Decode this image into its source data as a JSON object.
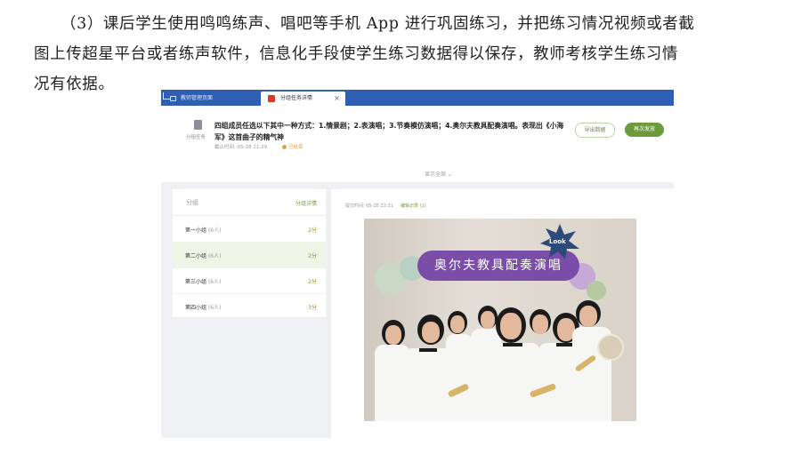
{
  "paragraph": {
    "line1": "（3）课后学生使用鸣鸣练声、唱吧等手机 App 进行巩固练习，并把练习情况视频或者截",
    "line2": "图上传超星平台或者练声软件，信息化手段使学生练习数据得以保存，教师考核学生练习情",
    "line3": "况有依据。"
  },
  "screenshot": {
    "tabs": [
      {
        "label": "教师管理页面"
      },
      {
        "label": "分组任务详情",
        "close": "×"
      }
    ],
    "task": {
      "icon_label": "分组任务",
      "title": "四组成员任选以下其中一种方式：1.情景剧；2.表演唱；3.节奏模仿演唱；4.奥尔夫教具配奏演唱。表现出《小海军》这首曲子的精气神",
      "deadline": "截止时间: 05-28 11:29",
      "status": "已结束",
      "export_button": "导出数据",
      "redo_button": "再次发放",
      "show_all": "显示全部 ⌄"
    },
    "groups": {
      "header_left": "分组",
      "header_right": "分组详情",
      "items": [
        {
          "name": "第一小组",
          "count": "(6人)",
          "score": "2分"
        },
        {
          "name": "第二小组",
          "count": "(6人)",
          "score": "2分"
        },
        {
          "name": "第三小组",
          "count": "(6人)",
          "score": "2分"
        },
        {
          "name": "第四小组",
          "count": "(6人)",
          "score": "3分"
        }
      ]
    },
    "submission": {
      "submit_time": "提交时间: 05-28 23:31",
      "edit_log": "编辑记录 (1)",
      "photo_banner": "奥尔夫教具配奏演唱",
      "photo_badge": "Look"
    }
  }
}
